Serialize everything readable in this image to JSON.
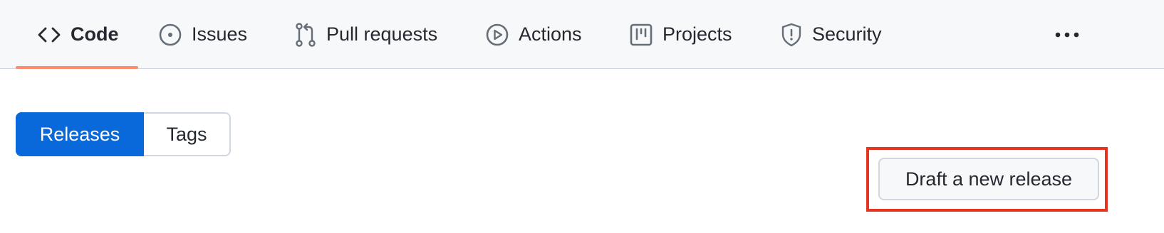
{
  "nav": {
    "tabs": [
      {
        "label": "Code",
        "icon": "code-icon",
        "selected": true
      },
      {
        "label": "Issues",
        "icon": "issue-opened-icon"
      },
      {
        "label": "Pull requests",
        "icon": "git-pull-request-icon"
      },
      {
        "label": "Actions",
        "icon": "play-icon"
      },
      {
        "label": "Projects",
        "icon": "project-icon"
      },
      {
        "label": "Security",
        "icon": "shield-icon"
      }
    ],
    "more_icon": "kebab-horizontal-icon",
    "selected_underline_color": "#fd8c73"
  },
  "releases_toggle": {
    "releases_label": "Releases",
    "tags_label": "Tags",
    "active": "Releases",
    "active_color": "#0969da"
  },
  "actions": {
    "draft_label": "Draft a new release",
    "highlight_color": "#e53420"
  }
}
